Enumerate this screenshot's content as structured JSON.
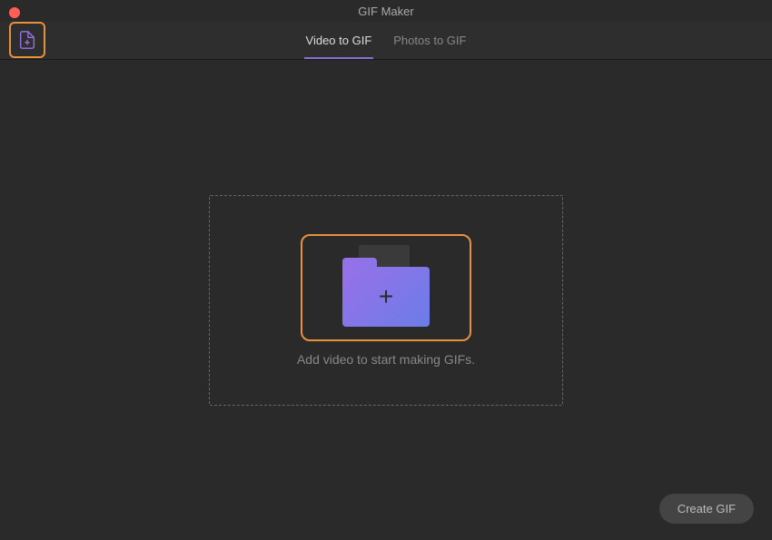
{
  "window": {
    "title": "GIF Maker"
  },
  "tabs": {
    "video_to_gif": "Video to GIF",
    "photos_to_gif": "Photos to GIF",
    "active": "video_to_gif"
  },
  "dropzone": {
    "prompt": "Add video to start making GIFs."
  },
  "actions": {
    "create_gif": "Create GIF"
  }
}
